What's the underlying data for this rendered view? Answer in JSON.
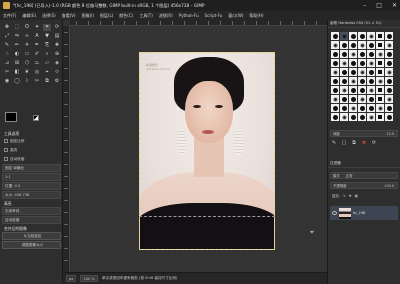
{
  "window": {
    "title": "*[hc_198] (已导入)-1.0 (RGB 颜色 8 位伽马整数, GIMP built-in sRGB, 1 个图层) 456x738 – GIMP",
    "controls": [
      "–",
      "□",
      "✕"
    ]
  },
  "menubar": [
    "文件(F)",
    "编辑(E)",
    "选择(S)",
    "查看(V)",
    "图像(I)",
    "图层(L)",
    "颜色(C)",
    "工具(T)",
    "滤镜(R)",
    "Python-Fu",
    "Script-Fu",
    "窗口(W)",
    "帮助(H)"
  ],
  "toolbox": {
    "tools": [
      {
        "icon": "move-icon",
        "glyph": "✥"
      },
      {
        "icon": "rect-select-icon",
        "glyph": "⬚"
      },
      {
        "icon": "lasso-icon",
        "glyph": "ʘ"
      },
      {
        "icon": "fuzzy-select-icon",
        "glyph": "✦"
      },
      {
        "icon": "crop-icon",
        "glyph": "⌗"
      },
      {
        "icon": "rotate-icon",
        "glyph": "⟳"
      },
      {
        "icon": "scale-icon",
        "glyph": "⤢"
      },
      {
        "icon": "flip-icon",
        "glyph": "⇋"
      },
      {
        "icon": "warp-icon",
        "glyph": "≈"
      },
      {
        "icon": "text-icon",
        "glyph": "A"
      },
      {
        "icon": "bucket-fill-icon",
        "glyph": "▼"
      },
      {
        "icon": "gradient-icon",
        "glyph": "▤"
      },
      {
        "icon": "paintbrush-icon",
        "glyph": "✎"
      },
      {
        "icon": "pencil-icon",
        "glyph": "✏"
      },
      {
        "icon": "airbrush-icon",
        "glyph": "✈"
      },
      {
        "icon": "ink-icon",
        "glyph": "✒"
      },
      {
        "icon": "clone-icon",
        "glyph": "⎘"
      },
      {
        "icon": "heal-icon",
        "glyph": "✚"
      },
      {
        "icon": "smudge-icon",
        "glyph": "☝"
      },
      {
        "icon": "dodge-icon",
        "glyph": "◐"
      },
      {
        "icon": "eraser-icon",
        "glyph": "▭"
      },
      {
        "icon": "paths-icon",
        "glyph": "✐"
      },
      {
        "icon": "color-picker-icon",
        "glyph": "⌕"
      },
      {
        "icon": "zoom-icon",
        "glyph": "⊕"
      },
      {
        "icon": "measure-icon",
        "glyph": "⊿"
      },
      {
        "icon": "align-icon",
        "glyph": "⊞"
      },
      {
        "icon": "cage-icon",
        "glyph": "⬡"
      },
      {
        "icon": "perspective-icon",
        "glyph": "⏢"
      },
      {
        "icon": "shear-icon",
        "glyph": "▱"
      },
      {
        "icon": "foreground-select-icon",
        "glyph": "◈"
      },
      {
        "icon": "scissors-icon",
        "glyph": "✂"
      },
      {
        "icon": "blend-icon",
        "glyph": "◧"
      },
      {
        "icon": "mypaint-icon",
        "glyph": "❦"
      },
      {
        "icon": "convolve-icon",
        "glyph": "◎"
      },
      {
        "icon": "handle-transform-icon",
        "glyph": "⌖"
      },
      {
        "icon": "unified-transform-icon",
        "glyph": "⟐"
      },
      {
        "icon": "color-select-icon",
        "glyph": "◉"
      },
      {
        "icon": "ellipse-select-icon",
        "glyph": "◯"
      },
      {
        "icon": "free-select-icon",
        "glyph": "⌇"
      },
      {
        "icon": "intelligent-scissors-icon",
        "glyph": "✄"
      },
      {
        "icon": "perspective-clone-icon",
        "glyph": "⧉"
      },
      {
        "icon": "gegl-icon",
        "glyph": "⚙"
      }
    ]
  },
  "tool_options": {
    "title": "工具选项",
    "rows": [
      {
        "kind": "head",
        "text": "  工具选项"
      },
      {
        "kind": "check",
        "text": "  固定比例"
      },
      {
        "kind": "check",
        "text": "  高亮"
      },
      {
        "kind": "check",
        "text": "  自动收缩"
      },
      {
        "kind": "box",
        "text": "固定 纵横比"
      },
      {
        "kind": "box",
        "text": "1:1"
      },
      {
        "kind": "box",
        "text": "位置: 0  0"
      },
      {
        "kind": "box",
        "text": "大小: 456  738"
      },
      {
        "kind": "head",
        "text": "  高亮"
      },
      {
        "kind": "box",
        "text": "无参考线"
      },
      {
        "kind": "box",
        "text": "自动收缩"
      },
      {
        "kind": "head",
        "text": "  合并后的图像"
      },
      {
        "kind": "btn",
        "text": "从当前选区"
      },
      {
        "kind": "btn",
        "text": "调整图像大小"
      }
    ]
  },
  "canvas": {
    "watermark_line1": "新浪娱乐",
    "watermark_line2": "ent.sina.com.cn"
  },
  "statusbar": {
    "unit": "px",
    "zoom": "100 %",
    "message": "单击或按回车键来裁剪 (按 Shift 保持尺寸比例)"
  },
  "right_dock": {
    "brushes_header": "画笔   Hardness 050 (51 × 51)",
    "spacing_label": "间距",
    "spacing_value": "10.0",
    "filter_label": "过滤器",
    "mode_label": "模式",
    "mode_value": "正常",
    "opacity_label": "不透明度",
    "opacity_value": "100.0",
    "lock_label": "锁定:",
    "layer_name": "hc_198"
  }
}
